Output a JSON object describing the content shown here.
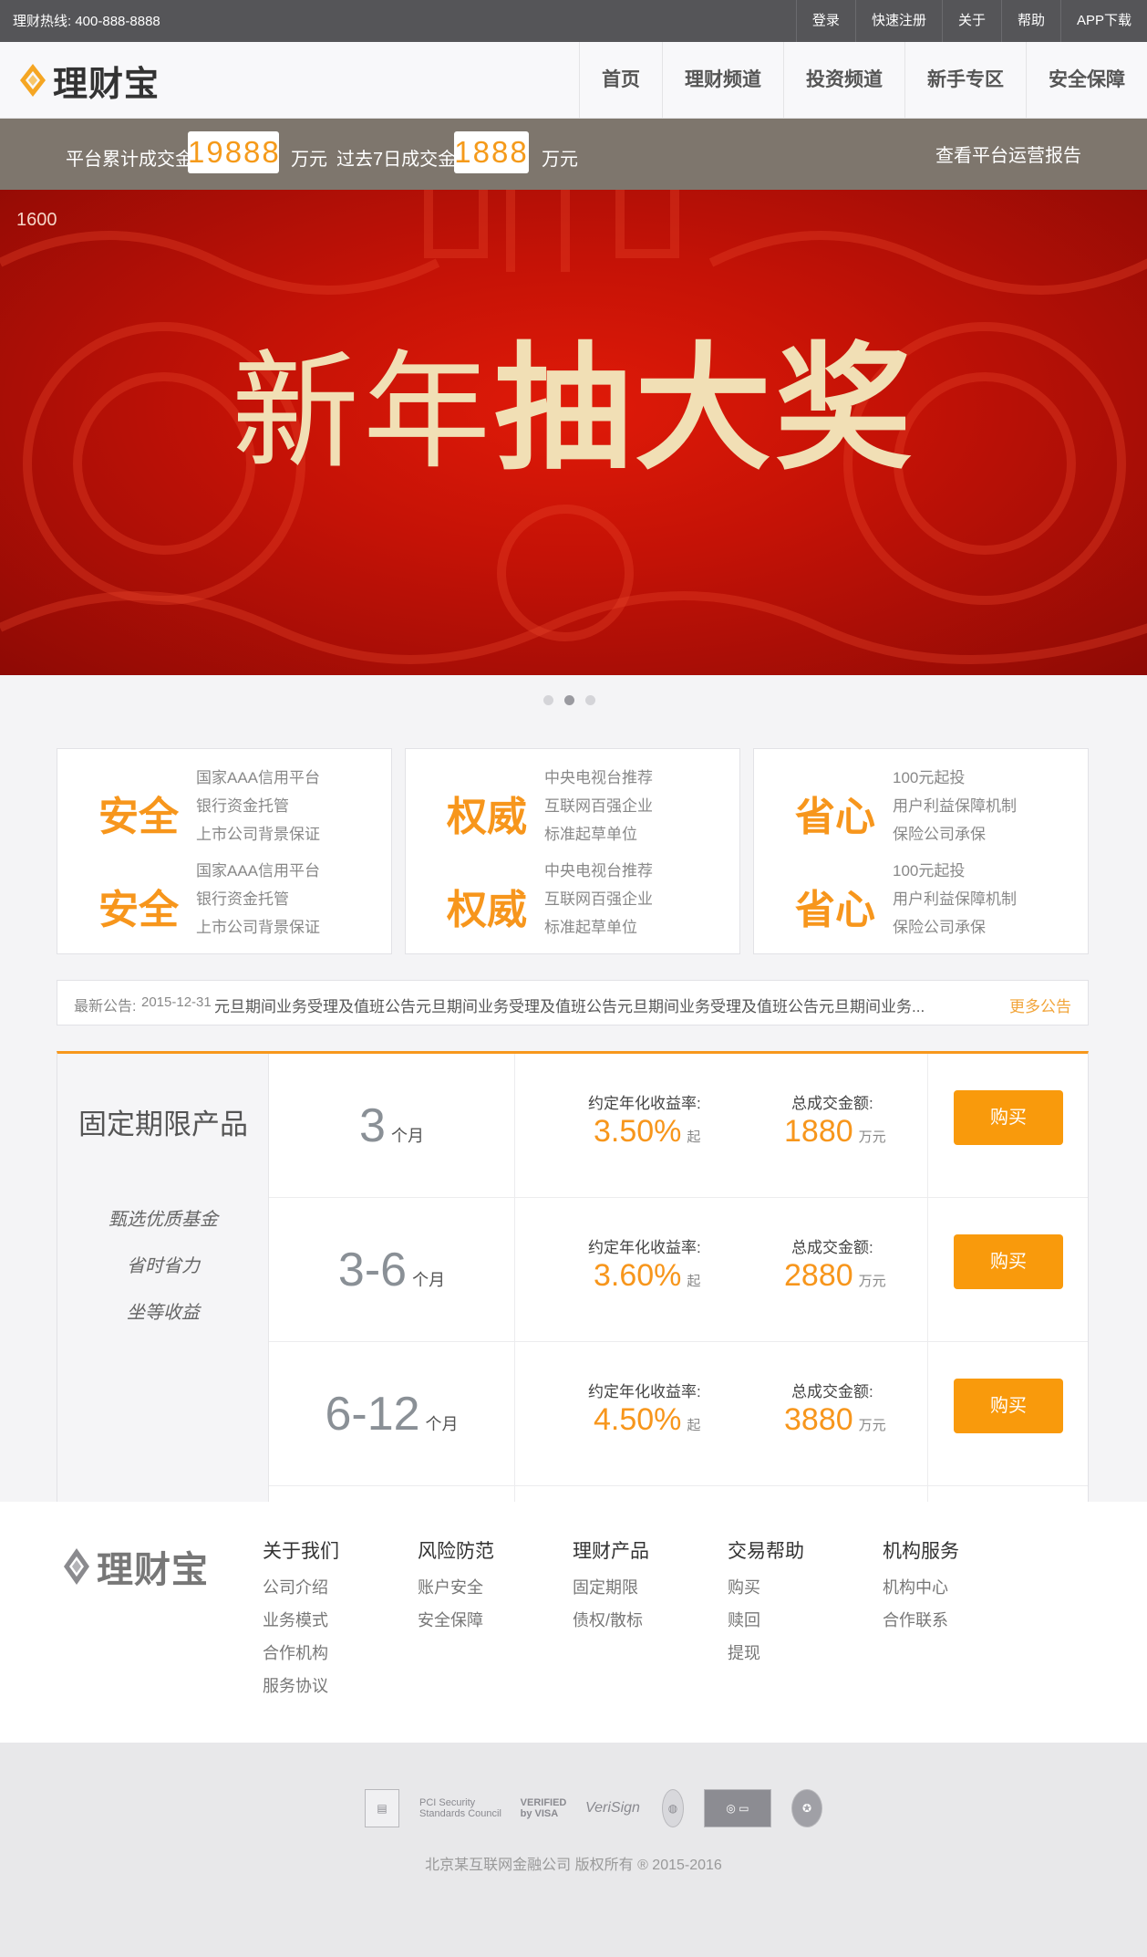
{
  "topbar": {
    "hotline": "理财热线: 400-888-8888",
    "links": [
      "登录",
      "快速注册",
      "关于",
      "帮助",
      "APP下载"
    ]
  },
  "header": {
    "logo_text": "理财宝",
    "nav": [
      "首页",
      "理财频道",
      "投资频道",
      "新手专区",
      "安全保障"
    ]
  },
  "stats": {
    "total_label": "平台累计成交金额",
    "total_value": "19888",
    "total_unit": "万元",
    "week_label": "过去7日成交金额",
    "week_value": "1888",
    "week_unit": "万元",
    "report_link": "查看平台运营报告"
  },
  "banner": {
    "tag": "1600",
    "title_light": "新年",
    "title_bold": "抽大奖",
    "background_color": "#c41206",
    "title_color": "#f1dfb5",
    "slides": 3,
    "active_slide": 2
  },
  "features": [
    {
      "rows": [
        {
          "title": "安全",
          "lines": [
            "国家AAA信用平台",
            "银行资金托管",
            "上市公司背景保证"
          ]
        },
        {
          "title": "安全",
          "lines": [
            "国家AAA信用平台",
            "银行资金托管",
            "上市公司背景保证"
          ]
        }
      ]
    },
    {
      "rows": [
        {
          "title": "权威",
          "lines": [
            "中央电视台推荐",
            "互联网百强企业",
            "标准起草单位"
          ]
        },
        {
          "title": "权威",
          "lines": [
            "中央电视台推荐",
            "互联网百强企业",
            "标准起草单位"
          ]
        }
      ]
    },
    {
      "rows": [
        {
          "title": "省心",
          "lines": [
            "100元起投",
            "用户利益保障机制",
            "保险公司承保"
          ]
        },
        {
          "title": "省心",
          "lines": [
            "100元起投",
            "用户利益保障机制",
            "保险公司承保"
          ]
        }
      ]
    }
  ],
  "notice": {
    "label": "最新公告:",
    "date": "2015-12-31",
    "text": "元旦期间业务受理及值班公告元旦期间业务受理及值班公告元旦期间业务受理及值班公告元旦期间业务...",
    "more": "更多公告"
  },
  "products": {
    "side_title": "固定期限产品",
    "side_tags": [
      "甄选优质基金",
      "省时省力",
      "坐等收益"
    ],
    "rate_label": "约定年化收益率:",
    "rate_suffix": "起",
    "total_label": "总成交金额:",
    "total_unit": "万元",
    "buy_label": "购买",
    "accent_color": "#f7961c",
    "items": [
      {
        "term": "3",
        "term_unit": "个月",
        "rate": "3.50%",
        "total": "1880"
      },
      {
        "term": "3-6",
        "term_unit": "个月",
        "rate": "3.60%",
        "total": "2880"
      },
      {
        "term": "6-12",
        "term_unit": "个月",
        "rate": "4.50%",
        "total": "3880"
      }
    ]
  },
  "footer": {
    "logo_text": "理财宝",
    "columns": [
      {
        "title": "关于我们",
        "items": [
          "公司介绍",
          "业务模式",
          "合作机构",
          "服务协议"
        ]
      },
      {
        "title": "风险防范",
        "items": [
          "账户安全",
          "安全保障"
        ]
      },
      {
        "title": "理财产品",
        "items": [
          "固定期限",
          "债权/散标"
        ]
      },
      {
        "title": "交易帮助",
        "items": [
          "购买",
          "赎回",
          "提现"
        ]
      },
      {
        "title": "机构服务",
        "items": [
          "机构中心",
          "合作联系"
        ]
      }
    ],
    "certs": [
      "PCI Security Standards Council",
      "VERIFIED by VISA",
      "VeriSign"
    ],
    "copyright": "北京某互联网金融公司 版权所有 ® 2015-2016"
  }
}
